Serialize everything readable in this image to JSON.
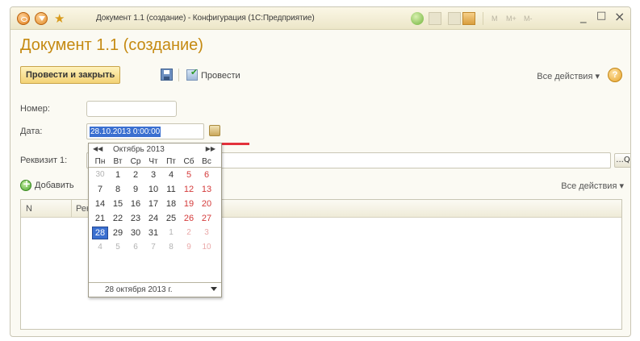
{
  "window": {
    "title": "Документ 1.1 (создание) - Конфигурация (1С:Предприятие)",
    "controls": [
      "M",
      "M+",
      "M-"
    ],
    "minimize": "_",
    "maximize": "□",
    "close": "×"
  },
  "document": {
    "title": "Документ 1.1 (создание)"
  },
  "toolbar": {
    "post_close_label": "Провести и закрыть",
    "post_label": "Провести",
    "all_actions_label": "Все действия ▾",
    "help_label": "?"
  },
  "fields": {
    "number_label": "Номер:",
    "number_value": "",
    "date_label": "Дата:",
    "date_value": "28.10.2013  0:00:00",
    "rekv_label": "Реквизит 1:",
    "rekv_value": "",
    "lookup_label": "...Q"
  },
  "table_toolbar": {
    "add_label": "Добавить",
    "all_actions_label": "Все действия ▾"
  },
  "table": {
    "columns": [
      "N",
      "Реквизит 3"
    ]
  },
  "calendar": {
    "prev": "◀◀",
    "month_label": "Октябрь 2013",
    "next": "▶▶",
    "days_of_week": [
      "Пн",
      "Вт",
      "Ср",
      "Чт",
      "Пт",
      "Сб",
      "Вс"
    ],
    "weeks": [
      [
        "30",
        "1",
        "2",
        "3",
        "4",
        "5",
        "6"
      ],
      [
        "7",
        "8",
        "9",
        "10",
        "11",
        "12",
        "13"
      ],
      [
        "14",
        "15",
        "16",
        "17",
        "18",
        "19",
        "20"
      ],
      [
        "21",
        "22",
        "23",
        "24",
        "25",
        "26",
        "27"
      ],
      [
        "28",
        "29",
        "30",
        "31",
        "1",
        "2",
        "3"
      ],
      [
        "4",
        "5",
        "6",
        "7",
        "8",
        "9",
        "10"
      ]
    ],
    "selected_day": "28",
    "footer_label": "28 октября 2013 г."
  },
  "colors": {
    "accent_title": "#c58a12",
    "selection": "#3a6fd0",
    "weekend": "#d43a3a",
    "annotation_line": "#e3323c"
  }
}
